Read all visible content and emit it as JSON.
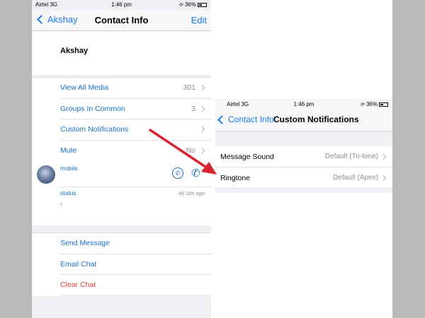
{
  "left_phone": {
    "status": {
      "carrier": "Airtel  3G",
      "time": "1:46 pm",
      "battery": "36%"
    },
    "nav": {
      "back": "Akshay",
      "title": "Contact Info",
      "edit": "Edit"
    },
    "contact_name": "Akshay",
    "items": [
      {
        "label": "View All Media",
        "value": "301"
      },
      {
        "label": "Groups In Common",
        "value": "3"
      },
      {
        "label": "Custom Notifications",
        "value": ""
      },
      {
        "label": "Mute",
        "value": "No"
      }
    ],
    "phone": {
      "label": "mobile"
    },
    "status_info": {
      "label": "status",
      "time": "4d 18h ago",
      "text": "."
    },
    "actions": [
      {
        "label": "Send Message"
      },
      {
        "label": "Email Chat"
      },
      {
        "label": "Clear Chat"
      }
    ]
  },
  "right_phone": {
    "status": {
      "carrier": "Airtel  3G",
      "time": "1:46 pm",
      "battery": "36%"
    },
    "nav": {
      "back": "Contact Info",
      "title": "Custom Notifications"
    },
    "items": [
      {
        "label": "Message Sound",
        "value": "Default (Tri-tone)"
      },
      {
        "label": "Ringtone",
        "value": "Default (Apex)"
      }
    ]
  },
  "colors": {
    "accent": "#1a6fc4",
    "destructive": "#e0403a",
    "arrow": "#d9232e",
    "background": "#b9b9b9"
  }
}
